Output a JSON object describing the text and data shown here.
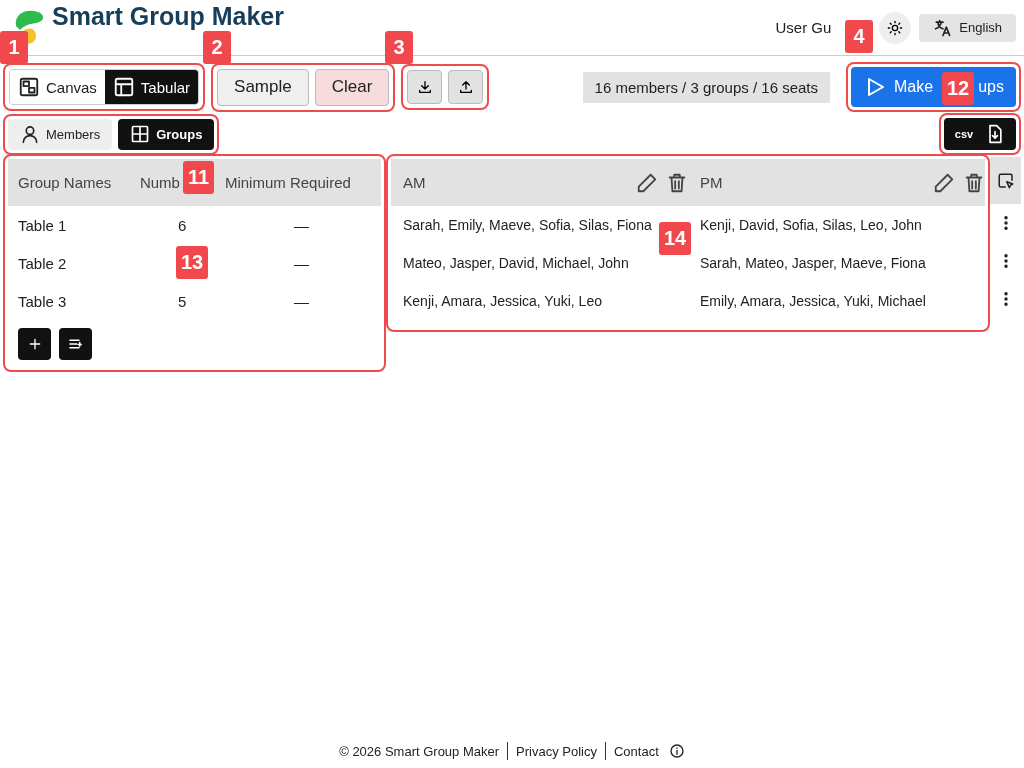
{
  "header": {
    "title": "Smart Group Maker",
    "user_guide_link": "User Gu",
    "language_button": "English"
  },
  "toolbar": {
    "view_toggle": [
      {
        "label": "Canvas",
        "selected": false
      },
      {
        "label": "Tabular",
        "selected": true
      }
    ],
    "data_buttons": [
      {
        "label": "Sample",
        "kind": "neutral"
      },
      {
        "label": "Clear",
        "kind": "danger"
      }
    ],
    "summary": "16 members / 3 groups / 16 seats",
    "make_groups_button": {
      "label_start": "Make",
      "label_end": "ups"
    }
  },
  "list_tabs": [
    {
      "label": "Members",
      "selected": false
    },
    {
      "label": "Groups",
      "selected": true
    }
  ],
  "csv_button": "csv",
  "groups_table": {
    "columns": [
      "Group Names",
      "Numb",
      "Minimum Required"
    ],
    "rows": [
      {
        "name": "Table 1",
        "number": "6",
        "minimum": "—"
      },
      {
        "name": "Table 2",
        "minimum": "—"
      },
      {
        "name": "Table 3",
        "number": "5",
        "minimum": "—"
      }
    ]
  },
  "sessions_table": {
    "columns": [
      "AM",
      "PM"
    ],
    "rows": [
      [
        "Sarah, Emily, Maeve, Sofia, Silas, Fiona",
        "Kenji, David, Sofia, Silas, Leo, John"
      ],
      [
        "Mateo, Jasper, David, Michael, John",
        "Sarah, Mateo, Jasper, Maeve, Fiona"
      ],
      [
        "Kenji, Amara, Jessica, Yuki, Leo",
        "Emily, Amara, Jessica, Yuki, Michael"
      ]
    ]
  },
  "annotation_badges": [
    "1",
    "2",
    "3",
    "4",
    "12",
    "11",
    "13",
    "14"
  ],
  "footer": {
    "copyright": "© 2026 Smart Group Maker",
    "links": [
      "Privacy Policy",
      "Contact"
    ]
  }
}
